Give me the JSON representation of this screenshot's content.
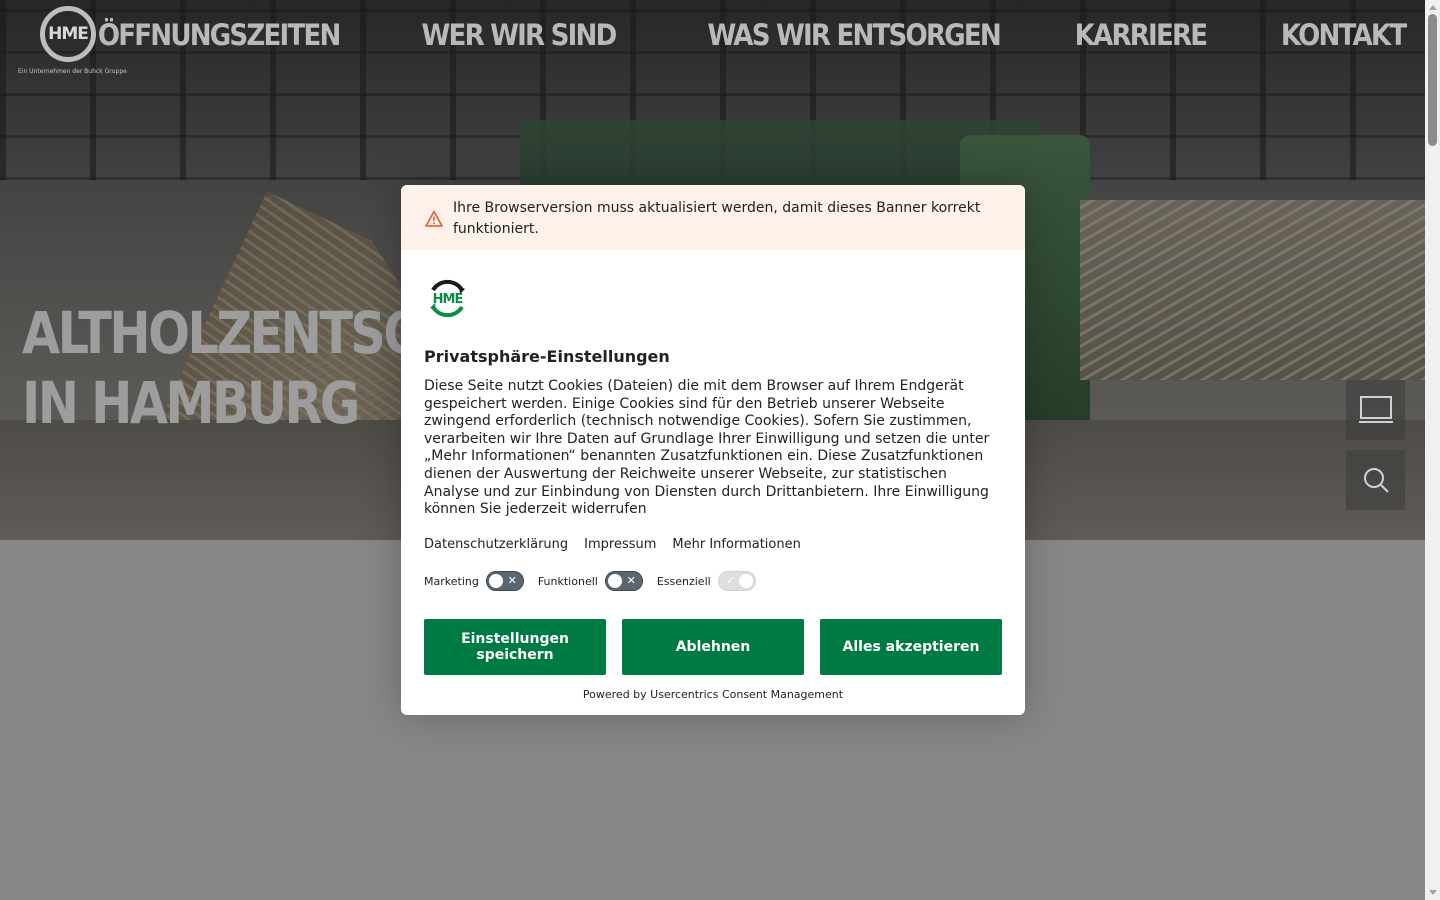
{
  "header": {
    "logo_text": "HME",
    "logo_tagline": "Ein Unternehmen der Buhck Gruppe",
    "nav": [
      {
        "label": "ÖFFNUNGSZEITEN"
      },
      {
        "label": "WER WIR SIND"
      },
      {
        "label": "WAS WIR ENTSORGEN"
      },
      {
        "label": "KARRIERE"
      },
      {
        "label": "KONTAKT"
      }
    ]
  },
  "hero": {
    "title_line1": "ALTHOLZENTSORGUNG",
    "title_line2": "IN HAMBURG"
  },
  "side_buttons": {
    "screen_icon": "monitor-icon",
    "search_icon": "search-icon"
  },
  "consent": {
    "warning": "Ihre Browserversion muss aktualisiert werden, damit dieses Banner korrekt funktioniert.",
    "title": "Privatsphäre-Einstellungen",
    "body": "Diese Seite nutzt Cookies (Dateien) die mit dem Browser auf Ihrem Endgerät gespeichert werden. Einige Cookies sind für den Betrieb unserer Webseite zwingend erforderlich (technisch notwendige Cookies). Sofern Sie zustimmen, verarbeiten wir Ihre Daten auf Grundlage Ihrer Einwilligung und setzen die unter „Mehr Informationen“ benannten Zusatzfunktionen ein. Diese Zusatzfunktionen dienen der Auswertung der Reichweite unserer Webseite, zur statistischen Analyse und zur Einbindung von Diensten durch Drittanbietern. Ihre Einwilligung können Sie jederzeit widerrufen",
    "links": {
      "privacy": "Datenschutzerklärung",
      "imprint": "Impressum",
      "more": "Mehr Informationen"
    },
    "toggles": {
      "marketing": "Marketing",
      "functional": "Funktionell",
      "essential": "Essenziell"
    },
    "buttons": {
      "save": "Einstellungen speichern",
      "deny": "Ablehnen",
      "accept": "Alles akzeptieren"
    },
    "powered_by": "Powered by Usercentrics Consent Management"
  },
  "colors": {
    "primary_green": "#007a43",
    "warning_bg": "#fdf1ea",
    "warning_icon": "#e0562e"
  }
}
